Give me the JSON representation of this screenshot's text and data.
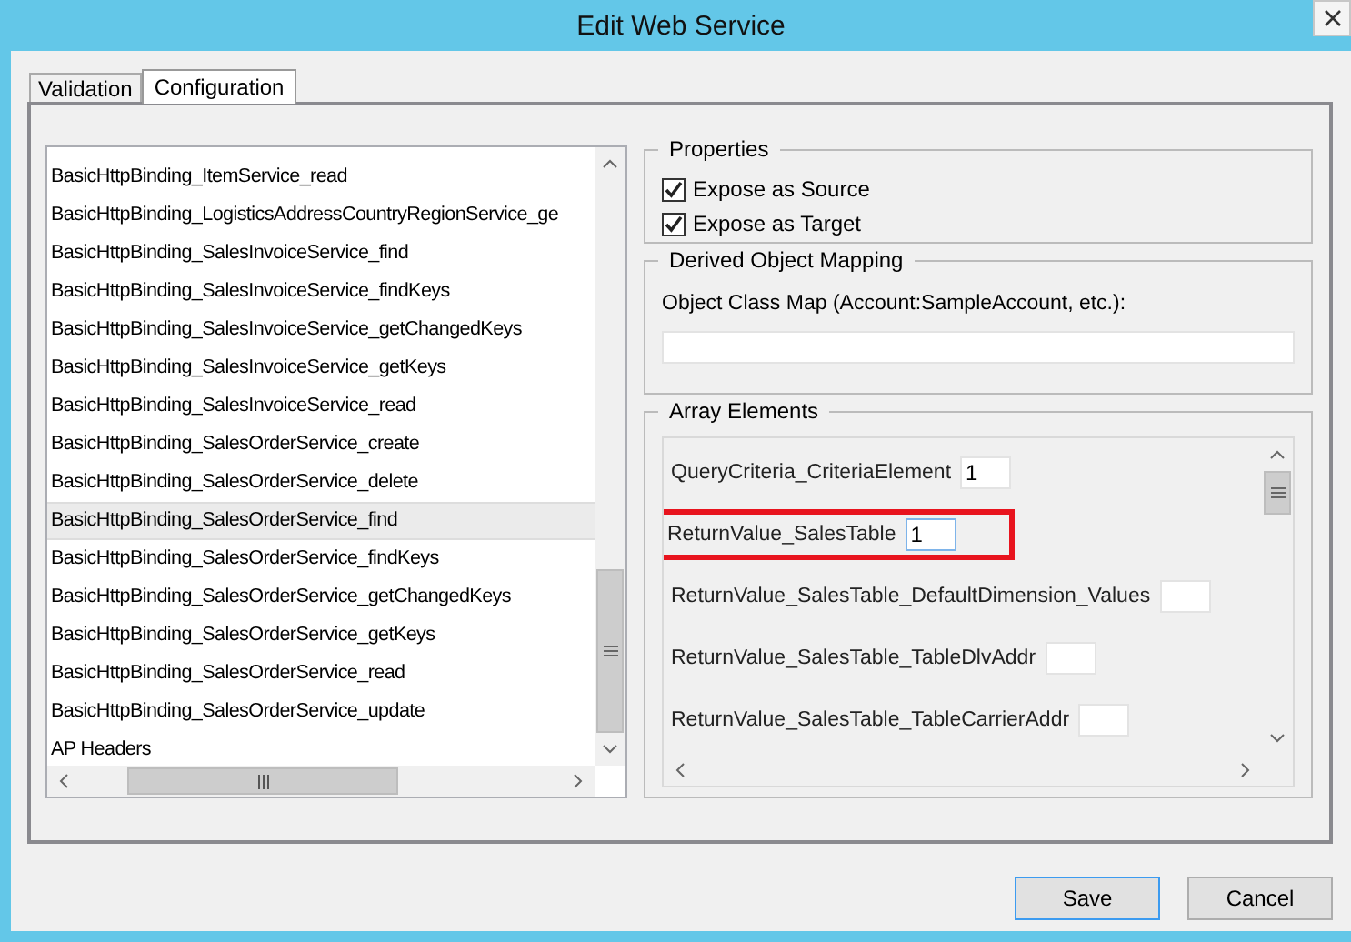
{
  "window": {
    "title": "Edit Web Service"
  },
  "tabs": [
    {
      "label": "Validation",
      "selected": false
    },
    {
      "label": "Configuration",
      "selected": true
    }
  ],
  "service_list": {
    "items": [
      {
        "label": "BasicHttpBinding_ItemService_read",
        "selected": false
      },
      {
        "label": "BasicHttpBinding_LogisticsAddressCountryRegionService_ge",
        "selected": false
      },
      {
        "label": "BasicHttpBinding_SalesInvoiceService_find",
        "selected": false
      },
      {
        "label": "BasicHttpBinding_SalesInvoiceService_findKeys",
        "selected": false
      },
      {
        "label": "BasicHttpBinding_SalesInvoiceService_getChangedKeys",
        "selected": false
      },
      {
        "label": "BasicHttpBinding_SalesInvoiceService_getKeys",
        "selected": false
      },
      {
        "label": "BasicHttpBinding_SalesInvoiceService_read",
        "selected": false
      },
      {
        "label": "BasicHttpBinding_SalesOrderService_create",
        "selected": false
      },
      {
        "label": "BasicHttpBinding_SalesOrderService_delete",
        "selected": false
      },
      {
        "label": "BasicHttpBinding_SalesOrderService_find",
        "selected": true
      },
      {
        "label": "BasicHttpBinding_SalesOrderService_findKeys",
        "selected": false
      },
      {
        "label": "BasicHttpBinding_SalesOrderService_getChangedKeys",
        "selected": false
      },
      {
        "label": "BasicHttpBinding_SalesOrderService_getKeys",
        "selected": false
      },
      {
        "label": "BasicHttpBinding_SalesOrderService_read",
        "selected": false
      },
      {
        "label": "BasicHttpBinding_SalesOrderService_update",
        "selected": false
      },
      {
        "label": "AP Headers",
        "selected": false
      }
    ]
  },
  "properties": {
    "title": "Properties",
    "options": [
      {
        "label": "Expose as Source",
        "checked": true
      },
      {
        "label": "Expose as Target",
        "checked": true
      }
    ]
  },
  "derived_object_mapping": {
    "title": "Derived Object Mapping",
    "field_label": "Object Class Map (Account:SampleAccount, etc.):"
  },
  "array_elements": {
    "title": "Array Elements",
    "items": [
      {
        "label": "QueryCriteria_CriteriaElement",
        "value": "1",
        "highlighted": false
      },
      {
        "label": "ReturnValue_SalesTable",
        "value": "1",
        "highlighted": true
      },
      {
        "label": "ReturnValue_SalesTable_DefaultDimension_Values",
        "highlighted": false
      },
      {
        "label": "ReturnValue_SalesTable_TableDlvAddr",
        "highlighted": false
      },
      {
        "label": "ReturnValue_SalesTable_TableCarrierAddr",
        "highlighted": false
      }
    ]
  },
  "buttons": [
    {
      "label": "Save",
      "kind": "default"
    },
    {
      "label": "Cancel",
      "kind": "normal"
    }
  ]
}
